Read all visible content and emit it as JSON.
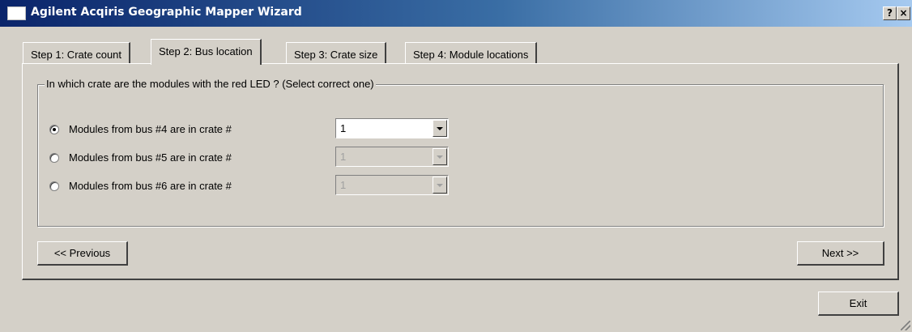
{
  "window": {
    "title": "Agilent Acqiris Geographic Mapper Wizard",
    "help_label": "?",
    "close_label": "×"
  },
  "tabs": [
    {
      "label": "Step 1: Crate count",
      "active": false
    },
    {
      "label": "Step 2: Bus location",
      "active": true
    },
    {
      "label": "Step 3: Crate size",
      "active": false
    },
    {
      "label": "Step 4: Module locations",
      "active": false
    }
  ],
  "group": {
    "legend": "In which crate are the modules with the red LED ? (Select correct one)",
    "rows": [
      {
        "label": "Modules from bus #4 are in crate #",
        "selected": true,
        "crate": "1",
        "enabled": true
      },
      {
        "label": "Modules from bus #5 are in crate #",
        "selected": false,
        "crate": "1",
        "enabled": false
      },
      {
        "label": "Modules from bus #6 are in crate #",
        "selected": false,
        "crate": "1",
        "enabled": false
      }
    ]
  },
  "buttons": {
    "previous": "<< Previous",
    "next": "Next >>",
    "exit": "Exit"
  },
  "colors": {
    "titlebar_start": "#0a246a",
    "titlebar_end": "#a6caf0",
    "face": "#d4d0c8"
  }
}
